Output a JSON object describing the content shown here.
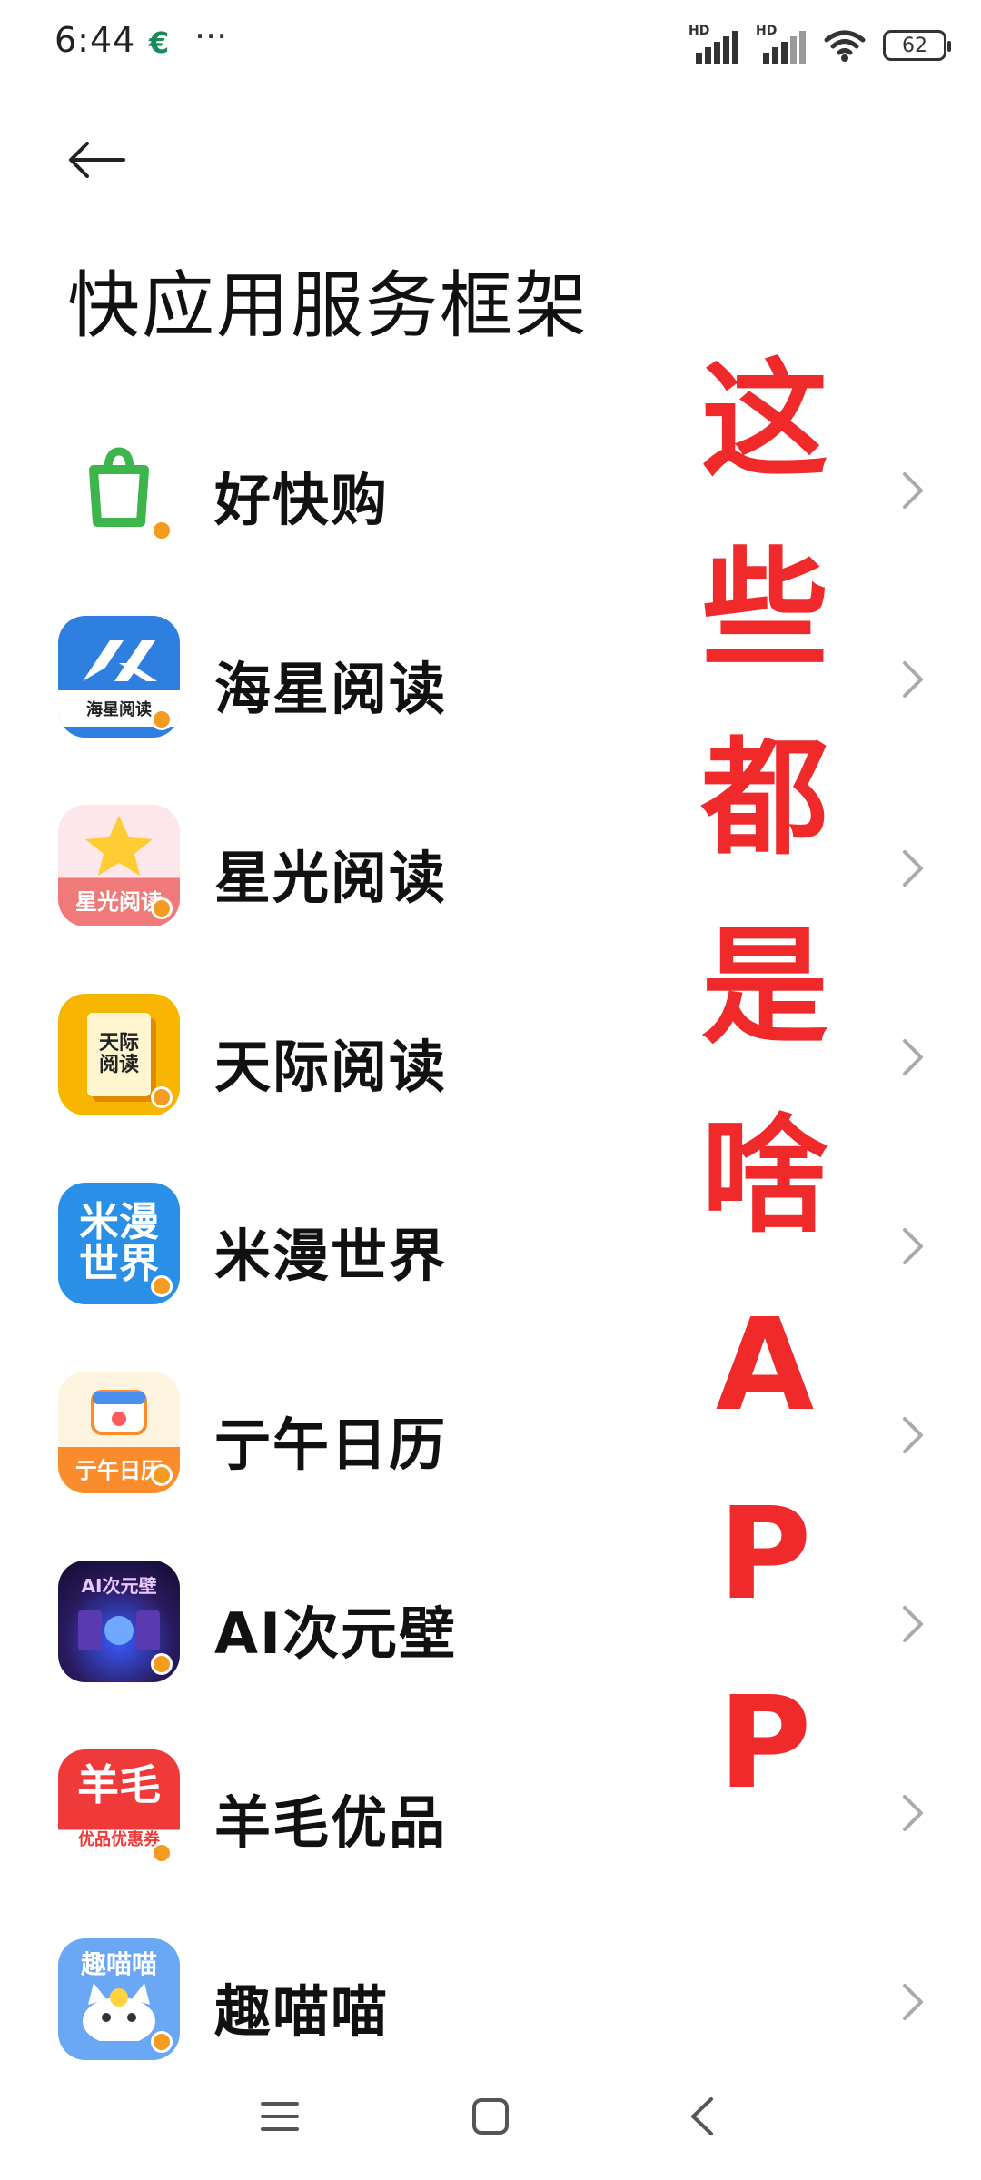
{
  "status_bar": {
    "time": "6:44",
    "app_icon_glyph": "€",
    "more": "···",
    "signal1_label": "HD",
    "signal2_label": "HD",
    "battery_level": "62"
  },
  "header": {
    "title": "快应用服务框架"
  },
  "apps": [
    {
      "name": "好快购",
      "icon_label": "",
      "icon_color": "#ffffff"
    },
    {
      "name": "海星阅读",
      "icon_label": "海星阅读",
      "icon_color": "#2f7fe0"
    },
    {
      "name": "星光阅读",
      "icon_label": "星光阅读",
      "icon_color": "#f07a7a"
    },
    {
      "name": "天际阅读",
      "icon_label": "天际阅读",
      "icon_color": "#f7b500"
    },
    {
      "name": "米漫世界",
      "icon_label": "米漫世界",
      "icon_color": "#2a8fe6"
    },
    {
      "name": "亍午日历",
      "icon_label": "亍午日历",
      "icon_color": "#fb8c2c"
    },
    {
      "name": "AI次元壁",
      "icon_label": "AI次元壁",
      "icon_color": "#2a1a5e"
    },
    {
      "name": "羊毛优品",
      "icon_label": "羊毛",
      "icon_sub": "优品优惠券",
      "icon_color": "#f03a3a"
    },
    {
      "name": "趣喵喵",
      "icon_label": "趣喵喵",
      "icon_color": "#6aa8f5"
    }
  ],
  "overlay": {
    "chars": [
      "这",
      "些",
      "都",
      "是",
      "啥",
      "A",
      "P",
      "P"
    ],
    "color": "#f02a2a"
  },
  "icons": {
    "back": "arrow-left-icon",
    "chevron": "chevron-right-icon",
    "nav_menu": "menu-icon",
    "nav_home": "home-icon",
    "nav_back": "back-icon"
  }
}
